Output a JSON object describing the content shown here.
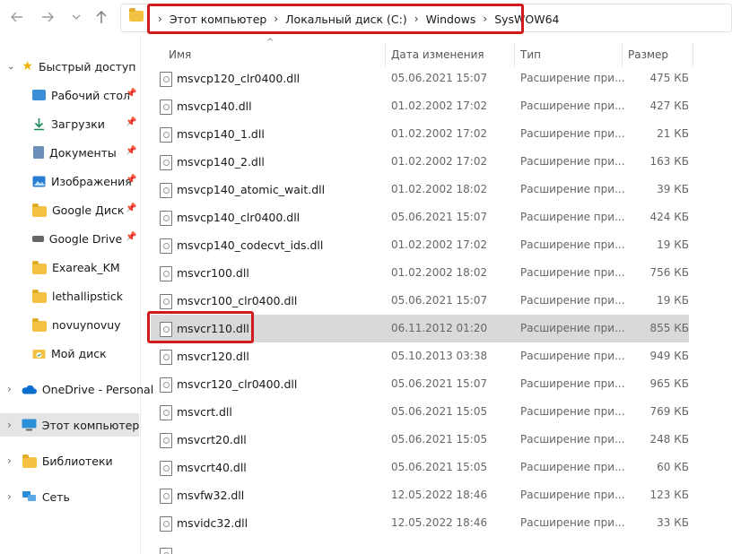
{
  "breadcrumb": [
    "Этот компьютер",
    "Локальный диск (C:)",
    "Windows",
    "SysWOW64"
  ],
  "columns": {
    "name": "Имя",
    "date": "Дата изменения",
    "type": "Тип",
    "size": "Размер"
  },
  "sidebar": {
    "quick_access": "Быстрый доступ",
    "items": [
      {
        "label": "Рабочий стол",
        "icon": "desktop-icon",
        "pinned": true
      },
      {
        "label": "Загрузки",
        "icon": "download-icon",
        "pinned": true
      },
      {
        "label": "Документы",
        "icon": "documents-icon",
        "pinned": true
      },
      {
        "label": "Изображения",
        "icon": "pictures-icon",
        "pinned": true
      },
      {
        "label": "Google Диск",
        "icon": "folder-icon",
        "pinned": true
      },
      {
        "label": "Google Drive (G",
        "icon": "drive-icon",
        "pinned": true
      },
      {
        "label": "Exareak_KM",
        "icon": "folder-icon",
        "pinned": false
      },
      {
        "label": "lethallipstick",
        "icon": "folder-icon",
        "pinned": false
      },
      {
        "label": "novuynovuy",
        "icon": "folder-icon",
        "pinned": false
      },
      {
        "label": "Мой диск",
        "icon": "cloud-folder-icon",
        "pinned": false
      }
    ],
    "onedrive": "OneDrive - Personal",
    "this_pc": "Этот компьютер",
    "libraries": "Библиотеки",
    "network": "Сеть"
  },
  "files": [
    {
      "name": "msvcp120_clr0400.dll",
      "date": "05.06.2021 15:07",
      "type": "Расширение при...",
      "size": "475 КБ"
    },
    {
      "name": "msvcp140.dll",
      "date": "01.02.2002 17:02",
      "type": "Расширение при...",
      "size": "427 КБ"
    },
    {
      "name": "msvcp140_1.dll",
      "date": "01.02.2002 17:02",
      "type": "Расширение при...",
      "size": "21 КБ"
    },
    {
      "name": "msvcp140_2.dll",
      "date": "01.02.2002 17:02",
      "type": "Расширение при...",
      "size": "163 КБ"
    },
    {
      "name": "msvcp140_atomic_wait.dll",
      "date": "01.02.2002 18:02",
      "type": "Расширение при...",
      "size": "39 КБ"
    },
    {
      "name": "msvcp140_clr0400.dll",
      "date": "05.06.2021 15:07",
      "type": "Расширение при...",
      "size": "424 КБ"
    },
    {
      "name": "msvcp140_codecvt_ids.dll",
      "date": "01.02.2002 17:02",
      "type": "Расширение при...",
      "size": "19 КБ"
    },
    {
      "name": "msvcr100.dll",
      "date": "01.02.2002 18:02",
      "type": "Расширение при...",
      "size": "756 КБ"
    },
    {
      "name": "msvcr100_clr0400.dll",
      "date": "05.06.2021 15:07",
      "type": "Расширение при...",
      "size": "19 КБ"
    },
    {
      "name": "msvcr110.dll",
      "date": "06.11.2012 01:20",
      "type": "Расширение при...",
      "size": "855 КБ",
      "selected": true
    },
    {
      "name": "msvcr120.dll",
      "date": "05.10.2013 03:38",
      "type": "Расширение при...",
      "size": "949 КБ"
    },
    {
      "name": "msvcr120_clr0400.dll",
      "date": "05.06.2021 15:07",
      "type": "Расширение при...",
      "size": "965 КБ"
    },
    {
      "name": "msvcrt.dll",
      "date": "05.06.2021 15:05",
      "type": "Расширение при...",
      "size": "769 КБ"
    },
    {
      "name": "msvcrt20.dll",
      "date": "05.06.2021 15:05",
      "type": "Расширение при...",
      "size": "248 КБ"
    },
    {
      "name": "msvcrt40.dll",
      "date": "05.06.2021 15:05",
      "type": "Расширение при...",
      "size": "60 КБ"
    },
    {
      "name": "msvfw32.dll",
      "date": "12.05.2022 18:46",
      "type": "Расширение при...",
      "size": "123 КБ"
    },
    {
      "name": "msvidc32.dll",
      "date": "12.05.2022 18:46",
      "type": "Расширение при...",
      "size": "33 КБ"
    }
  ],
  "colors": {
    "highlight_border": "#d11a1a",
    "selected_row": "#d9d9d9",
    "folder": "#f3c243",
    "onedrive": "#0a6fd1"
  }
}
